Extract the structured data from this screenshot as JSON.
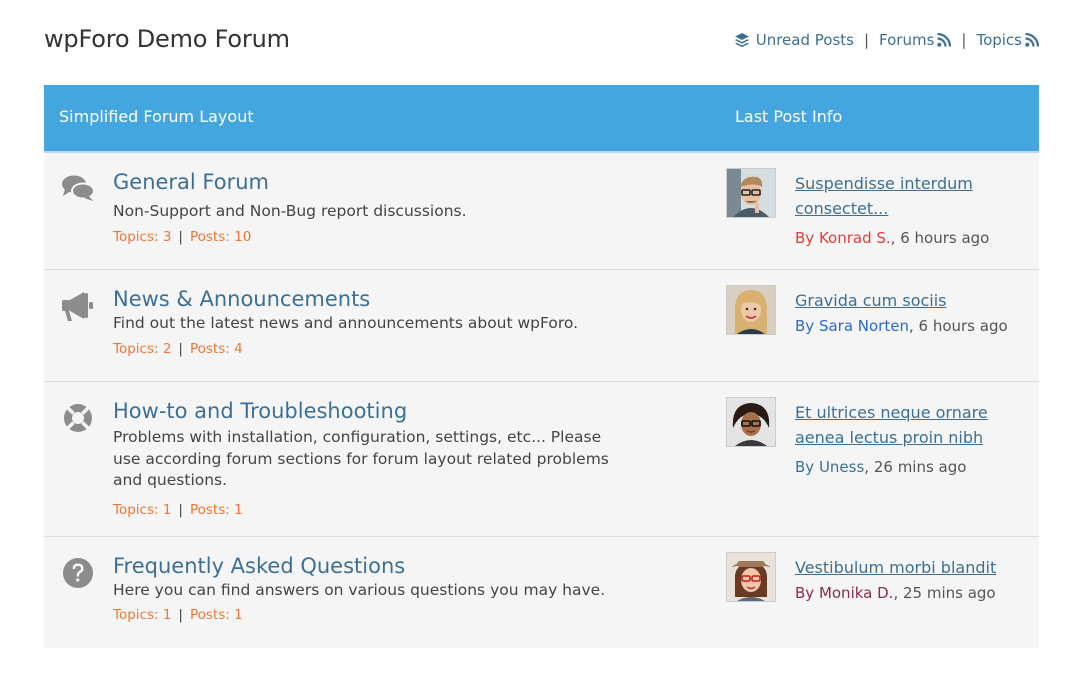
{
  "site": {
    "title": "wpForo Demo Forum"
  },
  "top_links": {
    "unread": "Unread Posts",
    "forums": "Forums",
    "topics": "Topics",
    "separator": "|"
  },
  "header": {
    "left": "Simplified Forum Layout",
    "right": "Last Post Info",
    "background": "#43a6df"
  },
  "colors": {
    "link": "#3d6f96",
    "stats": "#ee7733",
    "row_bg": "#f5f5f5"
  },
  "forums": [
    {
      "icon": "comments-icon",
      "title": "General Forum",
      "description": "Non-Support and Non-Bug report discussions.",
      "topics": "Topics: 3",
      "posts": "Posts: 10",
      "last_post": {
        "title": "Suspendisse interdum consectet...",
        "by_prefix": "By ",
        "author": "Konrad S.",
        "author_color": "#e0403a",
        "time": ", 6 hours ago"
      }
    },
    {
      "icon": "bullhorn-icon",
      "title": "News & Announcements",
      "description": "Find out the latest news and announcements about wpForo.",
      "topics": "Topics: 2",
      "posts": "Posts: 4",
      "last_post": {
        "title": "Gravida cum sociis",
        "by_prefix": "By ",
        "author": "Sara Norten",
        "author_color": "#2a6bd1",
        "time": ", 6 hours ago"
      }
    },
    {
      "icon": "life-ring-icon",
      "title": "How-to and Troubleshooting",
      "description": "Problems with installation, configuration, settings, etc... Please use according forum sections for forum layout related problems and questions.",
      "topics": "Topics: 1",
      "posts": "Posts: 1",
      "last_post": {
        "title": "Et ultrices neque ornare aenea lectus proin nibh",
        "by_prefix": "By ",
        "author": "Uness",
        "author_color": "#3d6f96",
        "time": ", 26 mins ago"
      }
    },
    {
      "icon": "question-circle-icon",
      "title": "Frequently Asked Questions",
      "description": "Here you can find answers on various questions you may have.",
      "topics": "Topics: 1",
      "posts": "Posts: 1",
      "last_post": {
        "title": "Vestibulum morbi blandit",
        "by_prefix": "By ",
        "author": "Monika D.",
        "author_color": "#8a2b52",
        "time": ", 25 mins ago"
      }
    }
  ]
}
